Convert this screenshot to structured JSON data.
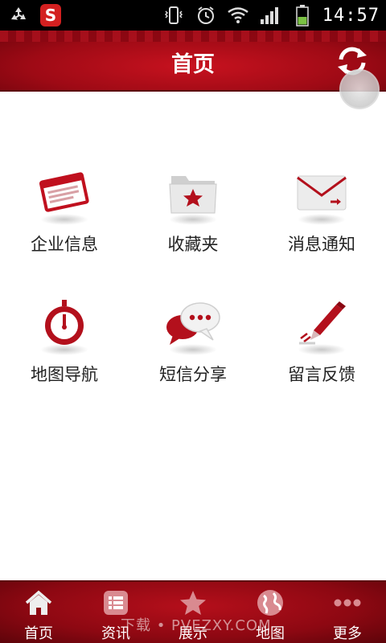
{
  "status_bar": {
    "time": "14:57"
  },
  "header": {
    "title": "首页"
  },
  "grid": [
    {
      "label": "企业信息",
      "icon": "business-card-icon"
    },
    {
      "label": "收藏夹",
      "icon": "favorites-folder-icon"
    },
    {
      "label": "消息通知",
      "icon": "mail-icon"
    },
    {
      "label": "地图导航",
      "icon": "compass-icon"
    },
    {
      "label": "短信分享",
      "icon": "chat-bubble-icon"
    },
    {
      "label": "留言反馈",
      "icon": "pen-feedback-icon"
    }
  ],
  "bottom_nav": [
    {
      "label": "首页",
      "icon": "home-icon"
    },
    {
      "label": "资讯",
      "icon": "news-icon"
    },
    {
      "label": "展示",
      "icon": "star-icon"
    },
    {
      "label": "地图",
      "icon": "globe-icon"
    },
    {
      "label": "更多",
      "icon": "more-icon"
    }
  ],
  "watermark": "下载 • PVEZXY.COM",
  "colors": {
    "brand_red": "#b50f1b",
    "dark_red": "#6e040c",
    "text": "#222222"
  }
}
